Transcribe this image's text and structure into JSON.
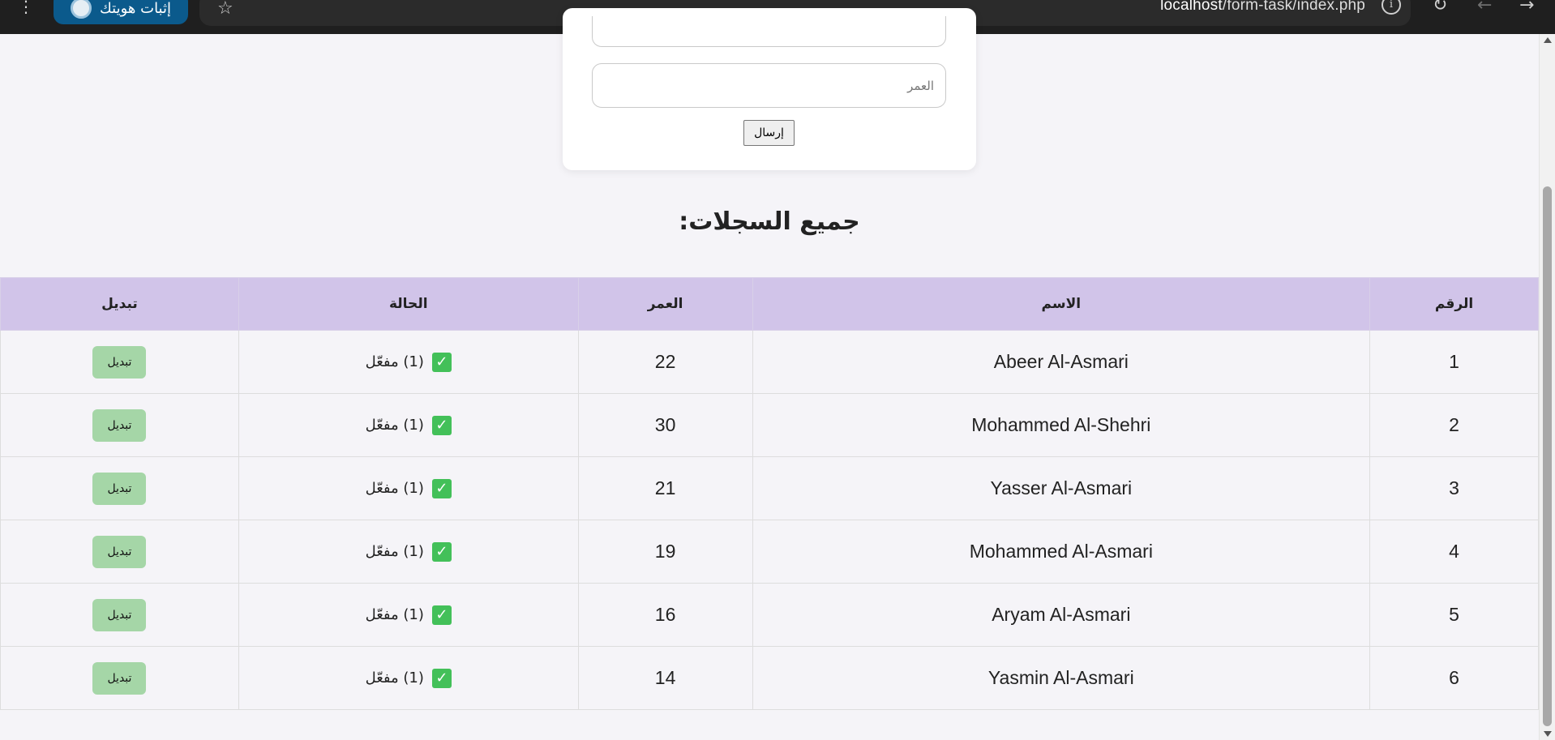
{
  "browser": {
    "menu_glyph": "⋮",
    "identity_button": "إثبات هويتك",
    "star_glyph": "☆",
    "url_host": "localhost",
    "url_path": "/form-task/index.php",
    "info_glyph": "i",
    "reload_glyph": "↻",
    "back_glyph": "←",
    "forward_glyph": "→",
    "icons": {
      "menu": "vertical-dots-icon",
      "star": "star-icon",
      "info": "info-icon",
      "reload": "reload-icon",
      "back": "back-arrow-icon",
      "forward": "forward-arrow-icon"
    }
  },
  "form": {
    "age_placeholder": "العمر",
    "submit_label": "إرسال"
  },
  "records": {
    "title": "جميع السجلات:",
    "headers": {
      "number": "الرقم",
      "name": "الاسم",
      "age": "العمر",
      "status": "الحالة",
      "toggle": "تبديل"
    },
    "rows": [
      {
        "number": "1",
        "name": "Abeer Al-Asmari",
        "age": "22",
        "status": "(1) مفعّل",
        "toggle": "تبديل"
      },
      {
        "number": "2",
        "name": "Mohammed Al-Shehri",
        "age": "30",
        "status": "(1) مفعّل",
        "toggle": "تبديل"
      },
      {
        "number": "3",
        "name": "Yasser Al-Asmari",
        "age": "21",
        "status": "(1) مفعّل",
        "toggle": "تبديل"
      },
      {
        "number": "4",
        "name": "Mohammed Al-Asmari",
        "age": "19",
        "status": "(1) مفعّل",
        "toggle": "تبديل"
      },
      {
        "number": "5",
        "name": "Aryam Al-Asmari",
        "age": "16",
        "status": "(1) مفعّل",
        "toggle": "تبديل"
      },
      {
        "number": "6",
        "name": "Yasmin Al-Asmari",
        "age": "14",
        "status": "(1) مفعّل",
        "toggle": "تبديل"
      }
    ],
    "check_glyph": "✓"
  },
  "colors": {
    "header_bg": "#d1c4e9",
    "toggle_bg": "#a5d6a7",
    "check_bg": "#43c059",
    "page_bg": "#f5f4f8"
  }
}
